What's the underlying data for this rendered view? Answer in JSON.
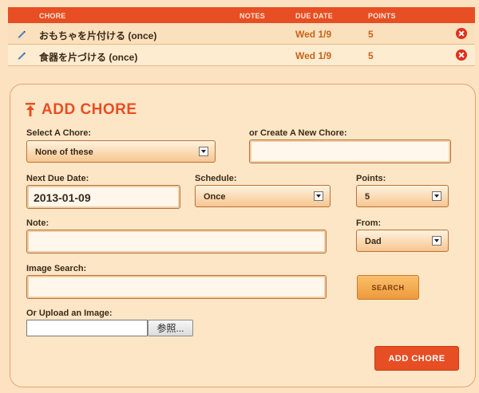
{
  "table": {
    "headers": {
      "chore": "CHORE",
      "notes": "NOTES",
      "due_date": "DUE DATE",
      "points": "POINTS"
    },
    "rows": [
      {
        "chore": "おもちゃを片付ける (once)",
        "notes": "",
        "due_date": "Wed 1/9",
        "points": "5"
      },
      {
        "chore": "食器を片づける (once)",
        "notes": "",
        "due_date": "Wed 1/9",
        "points": "5"
      }
    ],
    "icons": {
      "edit": "pencil-icon",
      "delete": "delete-x-icon"
    },
    "colors": {
      "header_bg": "#e84e23",
      "delete": "#e0301e",
      "value_text": "#c6641e"
    }
  },
  "form": {
    "title": "ADD CHORE",
    "title_icon": "arrow-up-icon",
    "select_chore": {
      "label": "Select A Chore:",
      "value": "None of these"
    },
    "create_chore": {
      "label": "or Create A New Chore:",
      "value": ""
    },
    "next_due": {
      "label": "Next Due Date:",
      "value": "2013-01-09"
    },
    "schedule": {
      "label": "Schedule:",
      "value": "Once"
    },
    "points": {
      "label": "Points:",
      "value": "5"
    },
    "note": {
      "label": "Note:",
      "value": ""
    },
    "from": {
      "label": "From:",
      "value": "Dad"
    },
    "image_search": {
      "label": "Image Search:",
      "value": "",
      "button": "SEARCH"
    },
    "upload": {
      "label": "Or Upload an Image:",
      "browse": "参照..."
    },
    "submit": "ADD CHORE",
    "colors": {
      "accent": "#e84e23",
      "panel_bg": "#fde6c6",
      "page_bg": "#fde2c2"
    }
  }
}
